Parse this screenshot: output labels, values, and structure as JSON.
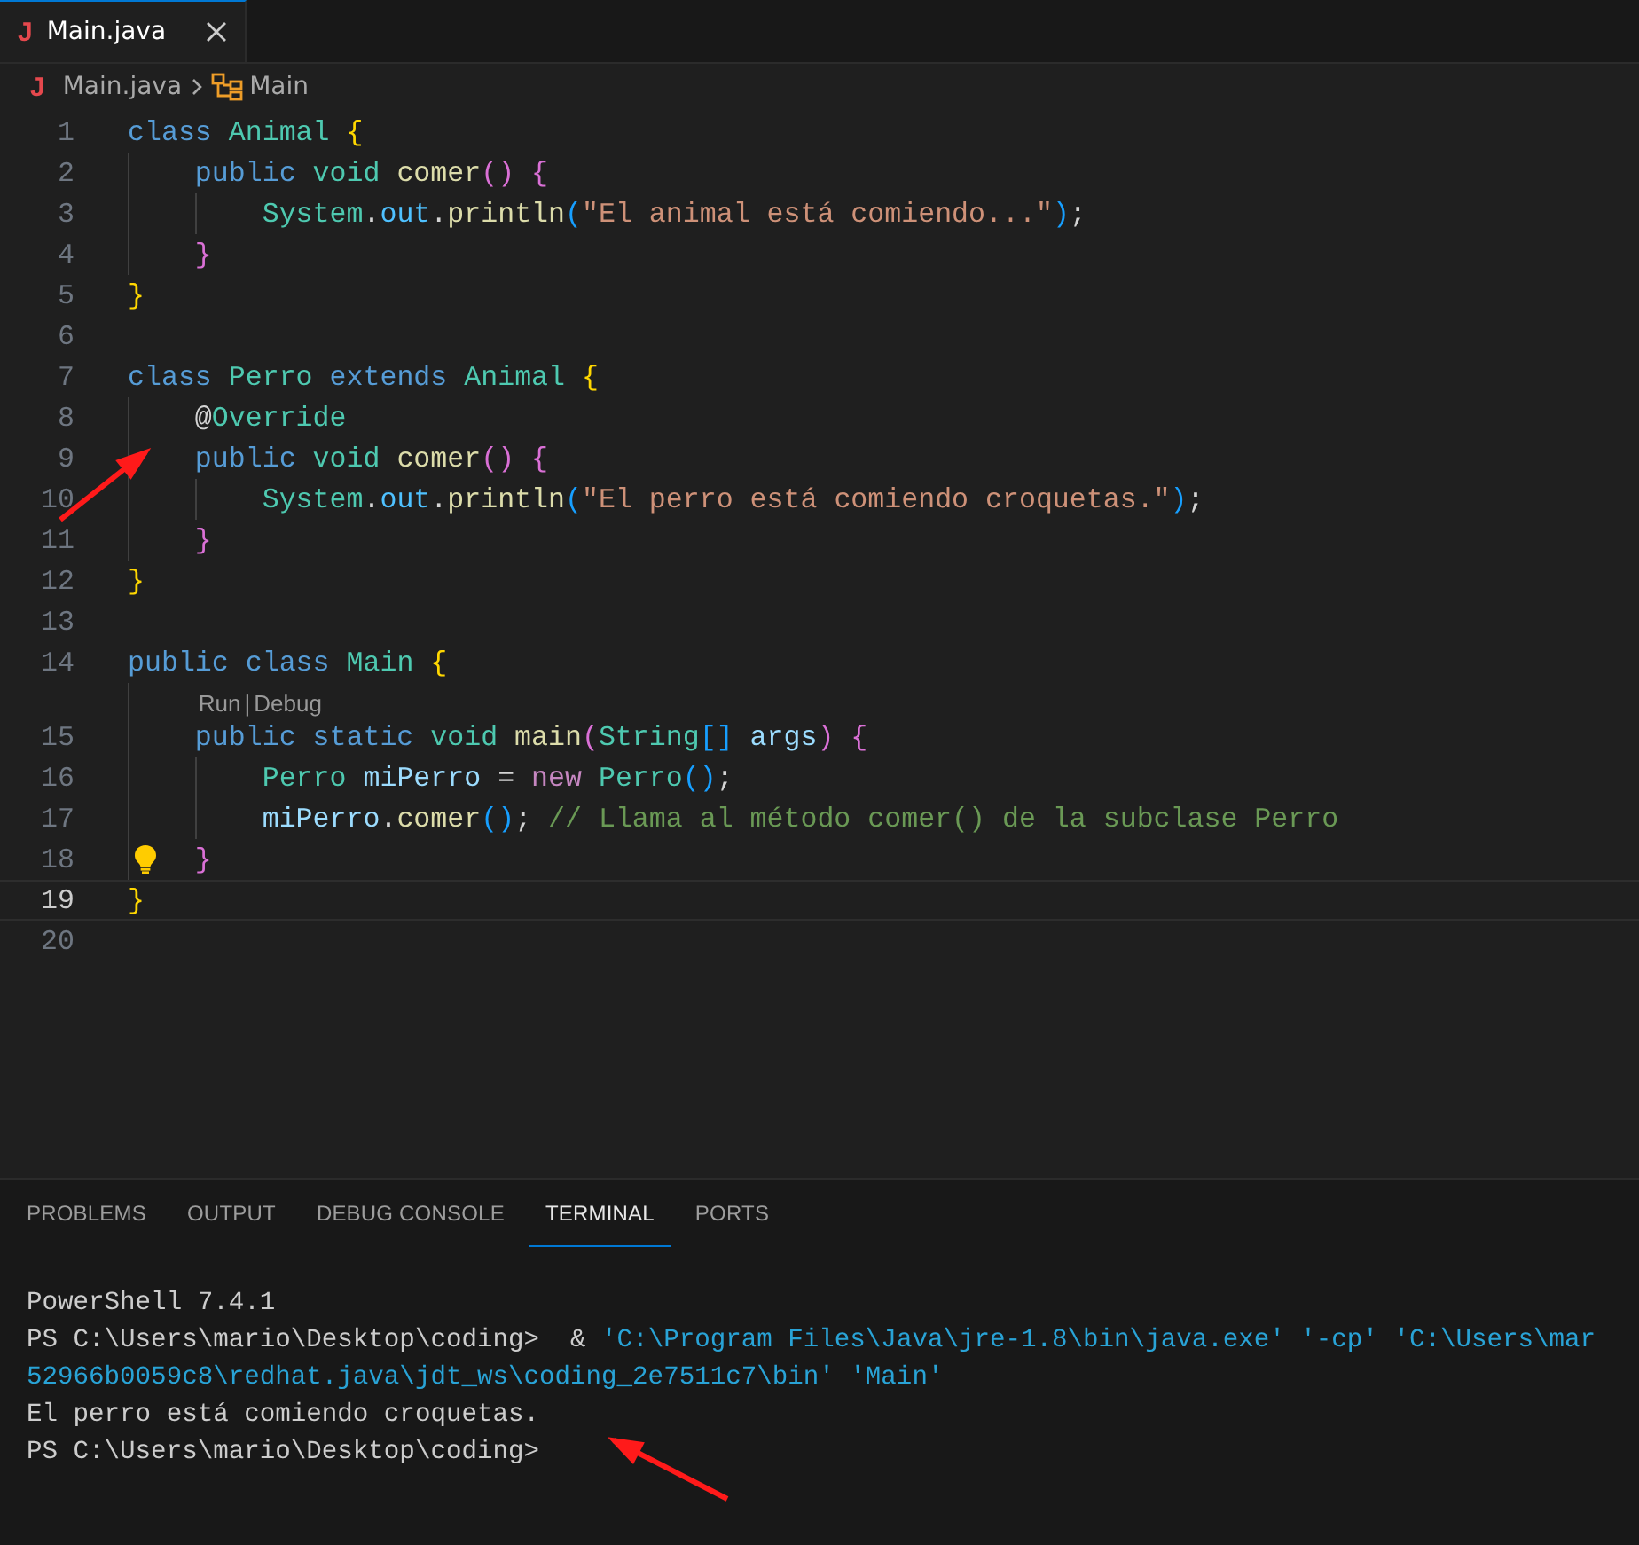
{
  "tabs": [
    {
      "file_icon": "J",
      "label": "Main.java",
      "selected": true
    }
  ],
  "breadcrumbs": {
    "file_icon": "J",
    "file": "Main.java",
    "symbol": "Main"
  },
  "lines": [
    {
      "number": "1",
      "current": false,
      "lightbulb": false,
      "tokens": [
        {
          "t": "class ",
          "kind": "kw"
        },
        {
          "t": "Animal ",
          "kind": "type"
        },
        {
          "t": "{",
          "kind": "b1"
        }
      ]
    },
    {
      "number": "2",
      "current": false,
      "lightbulb": false,
      "tokens": [
        {
          "t": "    public ",
          "kind": "kw"
        },
        {
          "t": "void ",
          "kind": "type"
        },
        {
          "t": "comer",
          "kind": "fn"
        },
        {
          "t": "() {",
          "kind": "b2"
        }
      ]
    },
    {
      "number": "3",
      "current": false,
      "lightbulb": false,
      "tokens": [
        {
          "t": "        System",
          "kind": "type"
        },
        {
          "t": ".",
          "kind": "p"
        },
        {
          "t": "out",
          "kind": "field"
        },
        {
          "t": ".",
          "kind": "p"
        },
        {
          "t": "println",
          "kind": "fn"
        },
        {
          "t": "(",
          "kind": "b3"
        },
        {
          "t": "\"El animal está comiendo...\"",
          "kind": "str"
        },
        {
          "t": ")",
          "kind": "b3"
        },
        {
          "t": ";",
          "kind": "p"
        }
      ]
    },
    {
      "number": "4",
      "current": false,
      "lightbulb": false,
      "tokens": [
        {
          "t": "    }",
          "kind": "b2"
        }
      ]
    },
    {
      "number": "5",
      "current": false,
      "lightbulb": false,
      "tokens": [
        {
          "t": "}",
          "kind": "b1"
        }
      ]
    },
    {
      "number": "6",
      "current": false,
      "lightbulb": false
    },
    {
      "number": "7",
      "current": false,
      "lightbulb": false,
      "tokens": [
        {
          "t": "class ",
          "kind": "kw"
        },
        {
          "t": "Perro ",
          "kind": "type"
        },
        {
          "t": "extends ",
          "kind": "kw"
        },
        {
          "t": "Animal ",
          "kind": "type"
        },
        {
          "t": "{",
          "kind": "b1"
        }
      ]
    },
    {
      "number": "8",
      "current": false,
      "lightbulb": false,
      "tokens": [
        {
          "t": "    @",
          "kind": "p"
        },
        {
          "t": "Override",
          "kind": "type"
        }
      ]
    },
    {
      "number": "9",
      "current": false,
      "lightbulb": false,
      "tokens": [
        {
          "t": "    public ",
          "kind": "kw"
        },
        {
          "t": "void ",
          "kind": "type"
        },
        {
          "t": "comer",
          "kind": "fn"
        },
        {
          "t": "() {",
          "kind": "b2"
        }
      ]
    },
    {
      "number": "10",
      "current": false,
      "lightbulb": false,
      "tokens": [
        {
          "t": "        System",
          "kind": "type"
        },
        {
          "t": ".",
          "kind": "p"
        },
        {
          "t": "out",
          "kind": "field"
        },
        {
          "t": ".",
          "kind": "p"
        },
        {
          "t": "println",
          "kind": "fn"
        },
        {
          "t": "(",
          "kind": "b3"
        },
        {
          "t": "\"El perro está comiendo croquetas.\"",
          "kind": "str"
        },
        {
          "t": ")",
          "kind": "b3"
        },
        {
          "t": ";",
          "kind": "p"
        }
      ]
    },
    {
      "number": "11",
      "current": false,
      "lightbulb": false,
      "tokens": [
        {
          "t": "    }",
          "kind": "b2"
        }
      ]
    },
    {
      "number": "12",
      "current": false,
      "lightbulb": false,
      "tokens": [
        {
          "t": "}",
          "kind": "b1"
        }
      ]
    },
    {
      "number": "13",
      "current": false,
      "lightbulb": false
    },
    {
      "number": "14",
      "current": false,
      "lightbulb": false,
      "tokens": [
        {
          "t": "public class ",
          "kind": "kw"
        },
        {
          "t": "Main ",
          "kind": "type"
        },
        {
          "t": "{",
          "kind": "b1"
        }
      ]
    },
    {
      "number": "15",
      "current": false,
      "lightbulb": false,
      "codelens": {
        "links": [
          "Run",
          "Debug"
        ],
        "separator": "|"
      },
      "tokens": [
        {
          "t": "    public static ",
          "kind": "kw"
        },
        {
          "t": "void ",
          "kind": "type"
        },
        {
          "t": "main",
          "kind": "fn"
        },
        {
          "t": "(",
          "kind": "b2"
        },
        {
          "t": "String",
          "kind": "type"
        },
        {
          "t": "[]",
          "kind": "b3"
        },
        {
          "t": " args",
          "kind": "var"
        },
        {
          "t": ") {",
          "kind": "b2"
        }
      ]
    },
    {
      "number": "16",
      "current": false,
      "lightbulb": false,
      "tokens": [
        {
          "t": "        Perro ",
          "kind": "type"
        },
        {
          "t": "miPerro",
          "kind": "var"
        },
        {
          "t": " = ",
          "kind": "p"
        },
        {
          "t": "new ",
          "kind": "ctl"
        },
        {
          "t": "Perro",
          "kind": "type"
        },
        {
          "t": "()",
          "kind": "b3"
        },
        {
          "t": ";",
          "kind": "p"
        }
      ]
    },
    {
      "number": "17",
      "current": false,
      "lightbulb": false,
      "tokens": [
        {
          "t": "        miPerro",
          "kind": "var"
        },
        {
          "t": ".",
          "kind": "p"
        },
        {
          "t": "comer",
          "kind": "fn"
        },
        {
          "t": "()",
          "kind": "b3"
        },
        {
          "t": ";",
          "kind": "p"
        },
        {
          "t": " // Llama al método comer() de la subclase Perro",
          "kind": "comment"
        }
      ]
    },
    {
      "number": "18",
      "current": false,
      "lightbulb": true,
      "tokens": [
        {
          "t": "    }",
          "kind": "b2"
        }
      ]
    },
    {
      "number": "19",
      "current": true,
      "lightbulb": false,
      "tokens": [
        {
          "t": "}",
          "kind": "b1"
        }
      ]
    },
    {
      "number": "20",
      "current": false,
      "lightbulb": false
    }
  ],
  "panel": {
    "tabs": [
      {
        "label": "PROBLEMS",
        "selected": false
      },
      {
        "label": "OUTPUT",
        "selected": false
      },
      {
        "label": "DEBUG CONSOLE",
        "selected": false
      },
      {
        "label": "TERMINAL",
        "selected": true
      },
      {
        "label": "PORTS",
        "selected": false
      }
    ],
    "terminal_lines": [
      [
        {
          "t": "PowerShell 7.4.1",
          "kind": "plain"
        }
      ],
      [
        {
          "t": "PS C:\\Users\\mario\\Desktop\\coding>  & ",
          "kind": "plain"
        },
        {
          "t": "'C:\\Program Files\\Java\\jre-1.8\\bin\\java.exe' '-cp' 'C:\\Users\\mar",
          "kind": "str"
        }
      ],
      [
        {
          "t": "52966b0059c8\\redhat.java\\jdt_ws\\coding_2e7511c7\\bin' 'Main'",
          "kind": "str"
        }
      ],
      [
        {
          "t": "El perro está comiendo croquetas.",
          "kind": "plain"
        }
      ],
      [
        {
          "t": "PS C:\\Users\\mario\\Desktop\\coding>",
          "kind": "plain"
        }
      ]
    ]
  },
  "annotations": [
    {
      "kind": "arrow"
    },
    {
      "kind": "arrow"
    }
  ]
}
